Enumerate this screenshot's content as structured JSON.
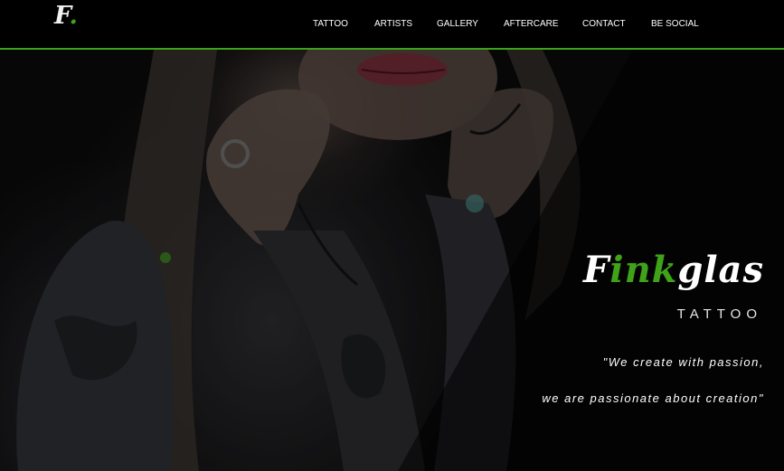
{
  "header": {
    "logo_letter": "F",
    "logo_dot": ".",
    "nav": [
      {
        "label": "TATTOO"
      },
      {
        "label": "ARTISTS"
      },
      {
        "label": "GALLERY"
      },
      {
        "label": "AFTERCARE"
      },
      {
        "label": "CONTACT"
      },
      {
        "label": "BE SOCIAL"
      }
    ]
  },
  "hero": {
    "title_prefix": "F",
    "title_highlight": "ink",
    "title_suffix": "glas",
    "subtitle": "TATTOO",
    "quote_line1": "\"We create with passion,",
    "quote_line2": "we are passionate about creation\""
  },
  "colors": {
    "accent": "#3fa31a",
    "background": "#000000",
    "text": "#ffffff"
  }
}
